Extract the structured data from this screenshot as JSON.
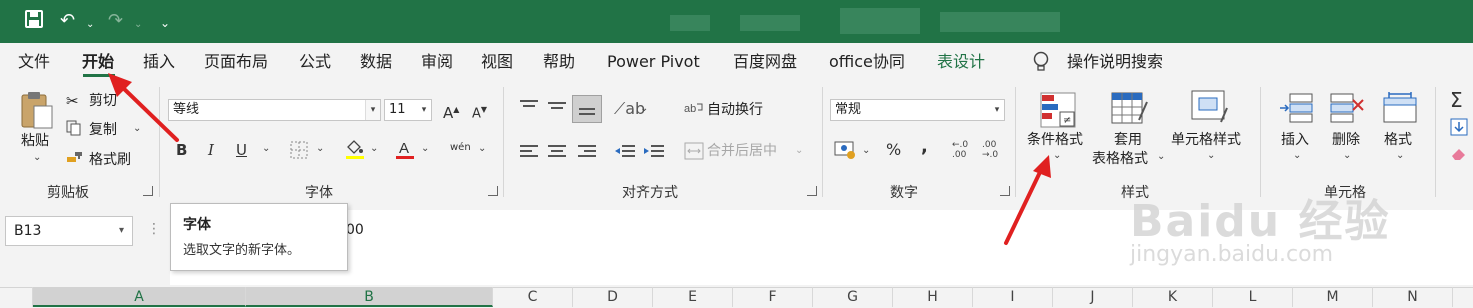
{
  "colors": {
    "brand_green": "#217346",
    "annotation_red": "#e02020"
  },
  "quick_access": {
    "save_icon": "save-icon",
    "undo_icon": "undo-icon",
    "redo_icon": "redo-icon",
    "customize_icon": "customize-icon"
  },
  "menu": {
    "file": "文件",
    "home": "开始",
    "insert": "插入",
    "page_layout": "页面布局",
    "formulas": "公式",
    "data": "数据",
    "review": "审阅",
    "view": "视图",
    "help": "帮助",
    "power_pivot": "Power Pivot",
    "baidu_disk": "百度网盘",
    "office_collab": "office协同",
    "table_design": "表设计",
    "tell_me": "操作说明搜索"
  },
  "clipboard": {
    "paste": "粘贴",
    "cut": "剪切",
    "copy": "复制",
    "format_painter": "格式刷",
    "group": "剪贴板"
  },
  "font": {
    "name": "等线",
    "size": "11",
    "bold": "B",
    "italic": "I",
    "underline": "U",
    "group": "字体",
    "wen": "wén"
  },
  "alignment": {
    "wrap_text": "自动换行",
    "merge_center": "合并后居中",
    "group": "对齐方式"
  },
  "number": {
    "format": "常规",
    "percent": "%",
    "comma": ",",
    "group": "数字"
  },
  "styles": {
    "conditional": "条件格式",
    "format_table_1": "套用",
    "format_table_2": "表格格式",
    "cell_styles": "单元格样式",
    "group": "样式"
  },
  "cells": {
    "insert": "插入",
    "delete": "删除",
    "format": "格式",
    "group": "单元格"
  },
  "namebox": {
    "value": "B13"
  },
  "formula": {
    "value": "00"
  },
  "tooltip": {
    "title": "字体",
    "description": "选取文字的新字体。"
  },
  "columns": [
    "A",
    "B",
    "C",
    "D",
    "E",
    "F",
    "G",
    "H",
    "I",
    "J",
    "K",
    "L",
    "M",
    "N"
  ],
  "watermark": {
    "line1": "Baidu 经验",
    "line2": "jingyan.baidu.com"
  }
}
